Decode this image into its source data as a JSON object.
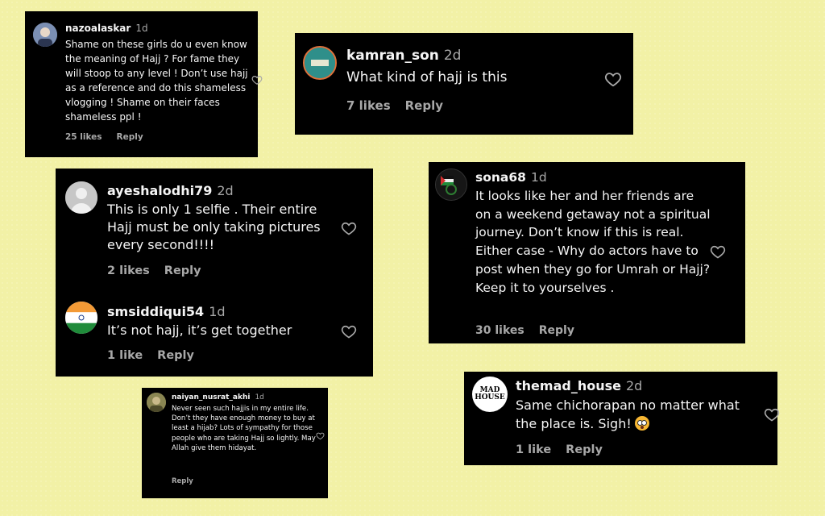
{
  "comments": [
    {
      "username": "nazoalaskar",
      "time": "1d",
      "text": "Shame on these girls do u even know the meaning of Hajj ? For fame they will stoop to any level ! Don’t use hajj as a reference and do this shameless vlogging ! Shame on their faces shameless ppl !",
      "likes": "25 likes",
      "reply": "Reply"
    },
    {
      "username": "kamran_son",
      "time": "2d",
      "text": "What kind of hajj is this",
      "likes": "7 likes",
      "reply": "Reply"
    },
    {
      "username": "ayeshalodhi79",
      "time": "2d",
      "text": "This is only 1 selfie . Their entire Hajj must be only taking pictures every second!!!!",
      "likes": "2 likes",
      "reply": "Reply"
    },
    {
      "username": "smsiddiqui54",
      "time": "1d",
      "text": "It’s not hajj, it’s get together",
      "likes": "1 like",
      "reply": "Reply"
    },
    {
      "username": "sona68",
      "time": "1d",
      "text": "It looks like her and her friends are on a weekend getaway not a spiritual journey. Don’t know if this is real. Either case - Why do actors have to post when they go for Umrah or Hajj? Keep it to yourselves .",
      "likes": "30 likes",
      "reply": "Reply"
    },
    {
      "username": "naiyan_nusrat_akhi",
      "time": "1d",
      "text": "Never seen such hajjis in my entire life. Don’t they have enough money to buy at least a hijab? Lots of sympathy for those people who are taking Hajj so lightly. May Allah give them hidayat.",
      "likes": "",
      "reply": "Reply"
    },
    {
      "username": "themad_house",
      "time": "2d",
      "text": "Same chichorapan no matter what the place is. Sigh!",
      "likes": "1 like",
      "reply": "Reply",
      "emoji": "flushed-face-emoji"
    }
  ],
  "avatar_logos": {
    "themad_house": "MAD HOUSE"
  },
  "colors": {
    "background": "#f2f1a6",
    "card": "#000000",
    "text": "#f5f5f5",
    "muted": "#a8a8a8"
  },
  "icons": {
    "like": "heart-outline-icon"
  }
}
